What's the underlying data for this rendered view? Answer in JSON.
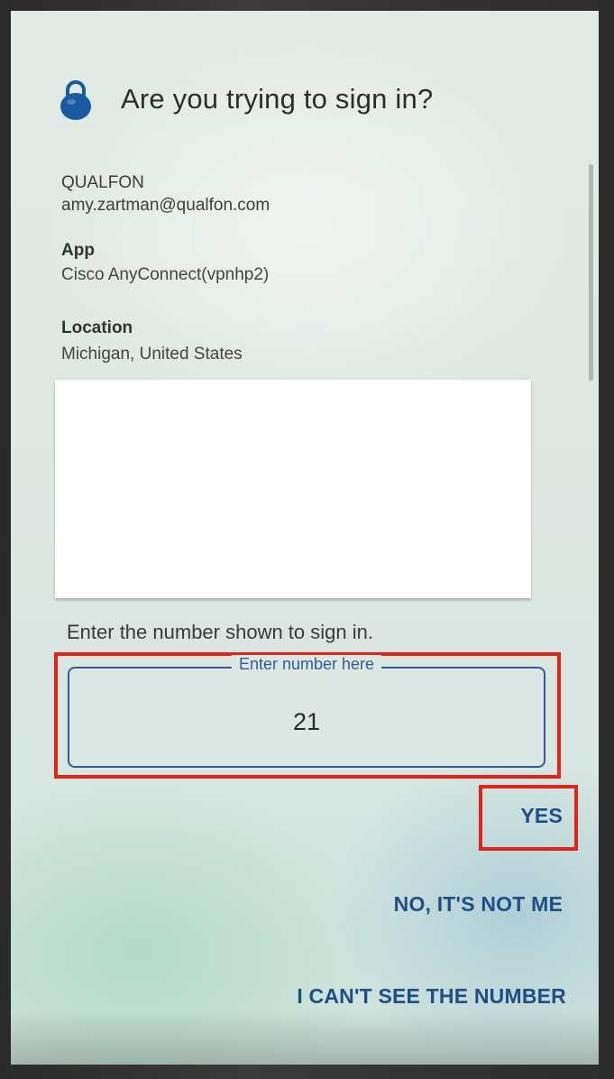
{
  "dialog": {
    "title": "Are you trying to sign in?",
    "organization": "QUALFON",
    "account": "amy.zartman@qualfon.com",
    "app_label": "App",
    "app_value": "Cisco AnyConnect(vpnhp2)",
    "location_label": "Location",
    "location_value": "Michigan, United States",
    "instruction": "Enter the number shown to sign in.",
    "number_field": {
      "legend": "Enter number here",
      "value": "21"
    },
    "actions": {
      "yes": "YES",
      "no": "NO, IT'S NOT ME",
      "cant_see": "I CAN'T SEE THE NUMBER"
    }
  },
  "colors": {
    "accent": "#1f4f86",
    "field_border": "#2f5d99",
    "highlight": "#e2231a"
  },
  "icons": {
    "title": "lock-icon"
  }
}
